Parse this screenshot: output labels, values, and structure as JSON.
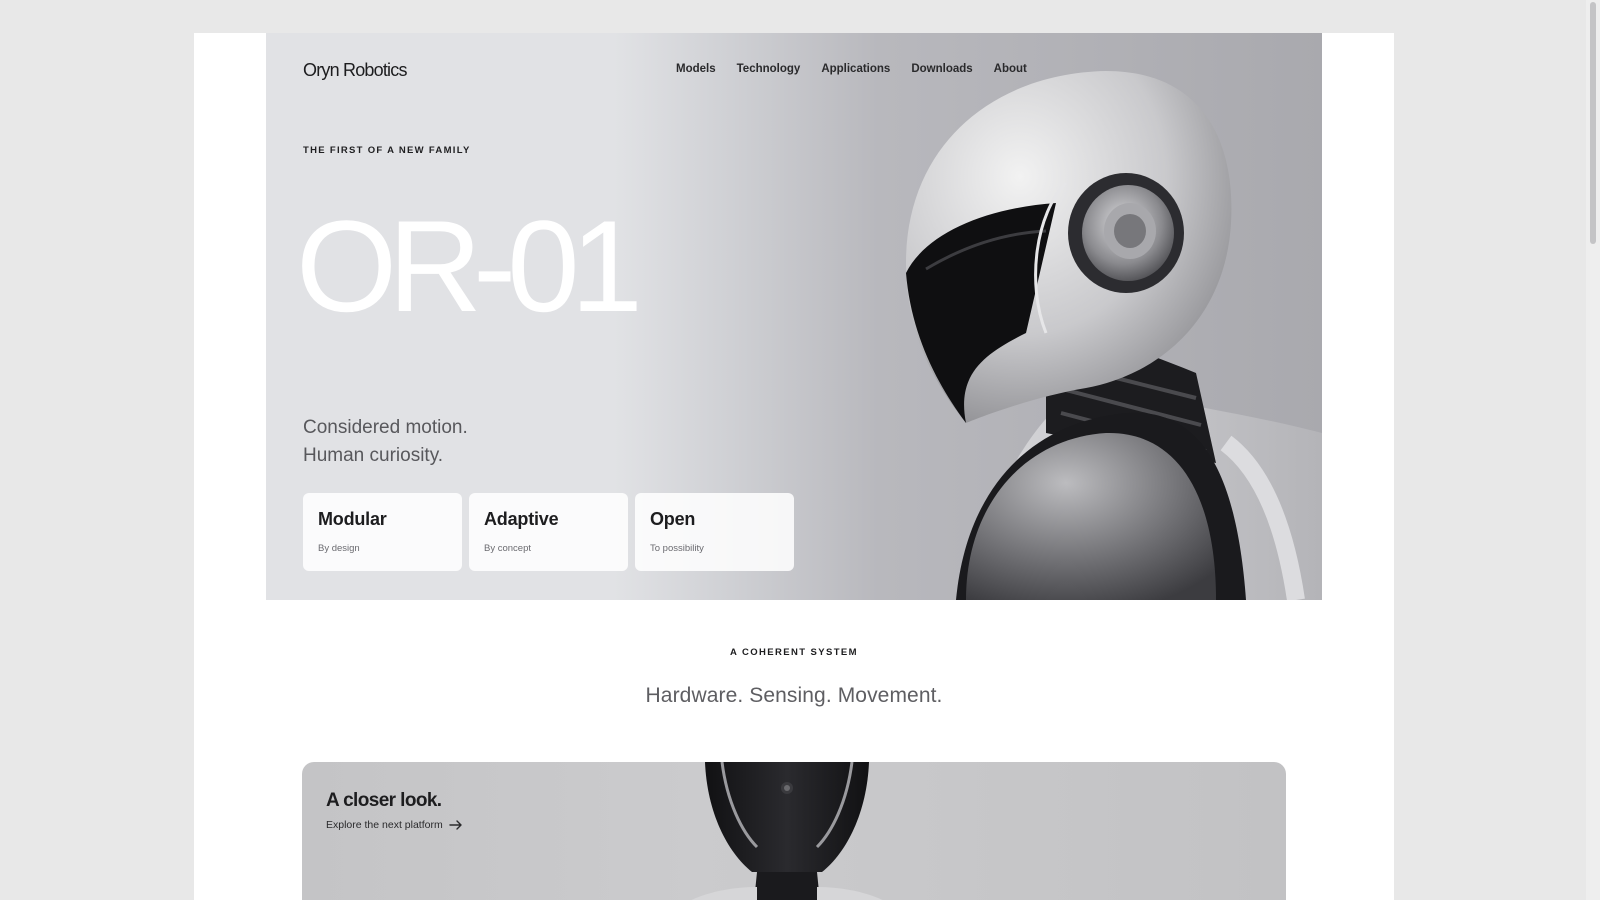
{
  "brand": {
    "logo_text": "Oryn Robotics"
  },
  "nav": {
    "links": [
      "Models",
      "Technology",
      "Applications",
      "Downloads",
      "About"
    ]
  },
  "hero": {
    "eyebrow": "THE FIRST OF A NEW FAMILY",
    "model_name": "OR-01",
    "tagline_line1": "Considered motion.",
    "tagline_line2": "Human curiosity.",
    "features": [
      {
        "title": "Modular",
        "subtitle": "By design"
      },
      {
        "title": "Adaptive",
        "subtitle": "By concept"
      },
      {
        "title": "Open",
        "subtitle": "To possibility"
      }
    ]
  },
  "system": {
    "eyebrow": "A COHERENT SYSTEM",
    "title": "Hardware. Sensing. Movement."
  },
  "closer_look": {
    "title": "A closer look.",
    "link_text": "Explore the next platform",
    "link_icon": "arrow-right-icon"
  },
  "colors": {
    "page_background": "#e8e8e8",
    "hero_light": "#e1e2e5",
    "hero_dark": "#a9a9ae",
    "text_primary": "#1d1d1f",
    "text_secondary": "#5e5e62"
  }
}
